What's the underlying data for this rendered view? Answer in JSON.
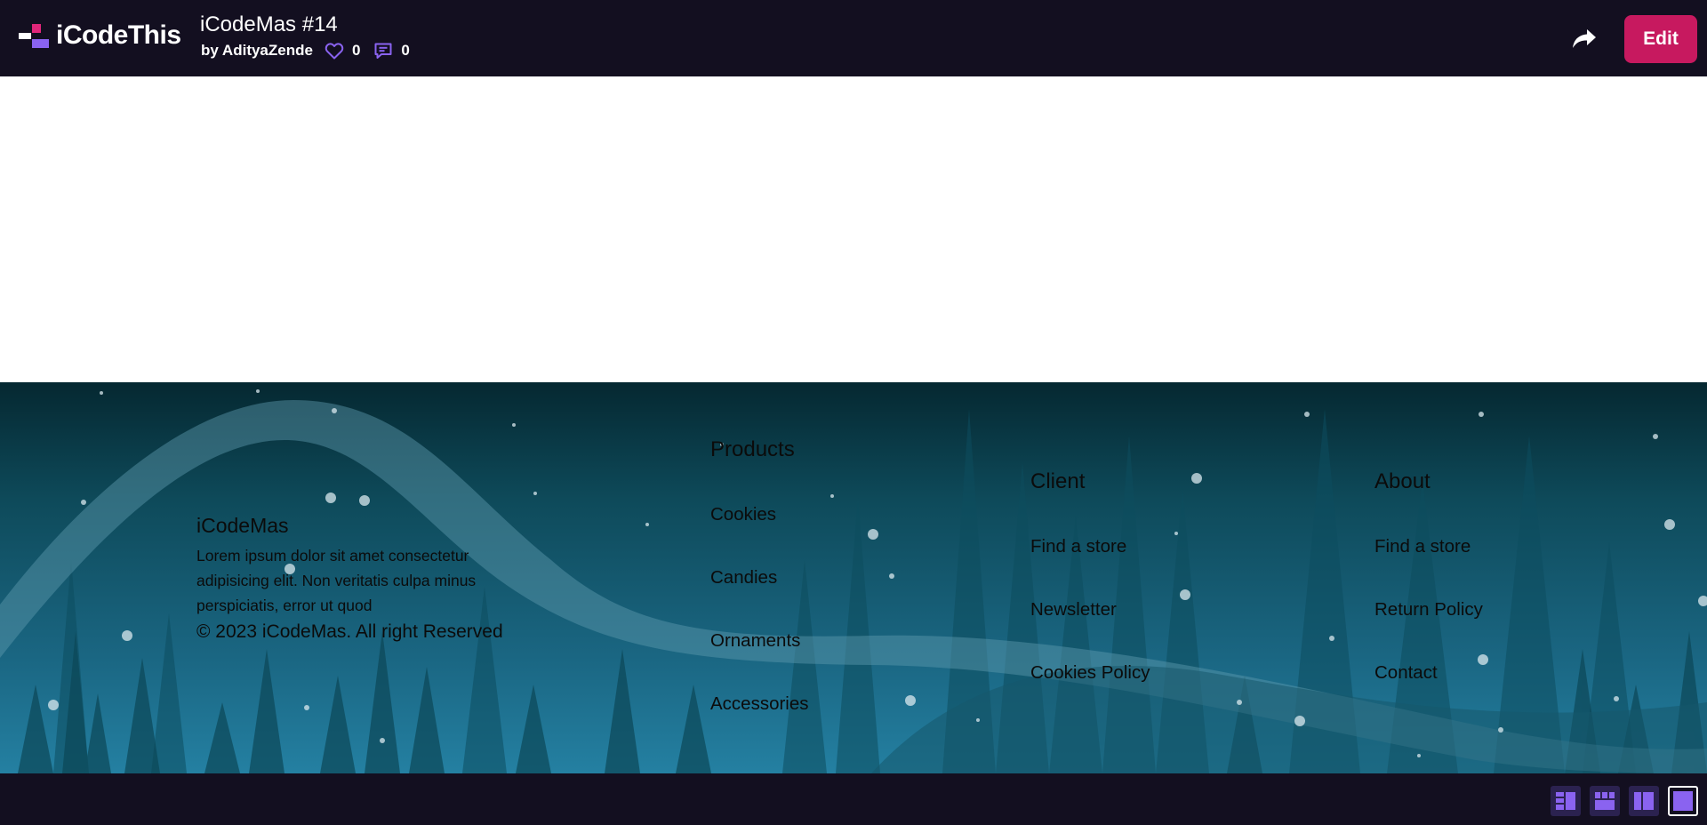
{
  "topbar": {
    "brand_name": "iCodeThis",
    "post_title": "iCodeMas #14",
    "author": "by AdityaZende",
    "likes": "0",
    "comments": "0",
    "edit_label": "Edit"
  },
  "footer": {
    "brand_title": "iCodeMas",
    "description": "Lorem ipsum dolor sit amet consectetur adipisicing elit. Non veritatis culpa minus perspiciatis, error ut quod",
    "copyright": "© 2023 iCodeMas. All right Reserved",
    "products": {
      "title": "Products",
      "items": [
        "Cookies",
        "Candies",
        "Ornaments",
        "Accessories"
      ]
    },
    "client": {
      "title": "Client",
      "items": [
        "Find a store",
        "Newsletter",
        "Cookies Policy"
      ]
    },
    "about": {
      "title": "About",
      "items": [
        "Find a store",
        "Return Policy",
        "Contact"
      ]
    }
  },
  "colors": {
    "topbar_bg": "#130f20",
    "accent_pink": "#c7195f",
    "accent_purple": "#8a63f0"
  },
  "bottombar": {
    "layout_buttons": [
      "layout-sidebar-icon",
      "layout-grid-icon",
      "layout-split-icon",
      "layout-full-icon"
    ],
    "active_layout": "layout-full-icon"
  }
}
